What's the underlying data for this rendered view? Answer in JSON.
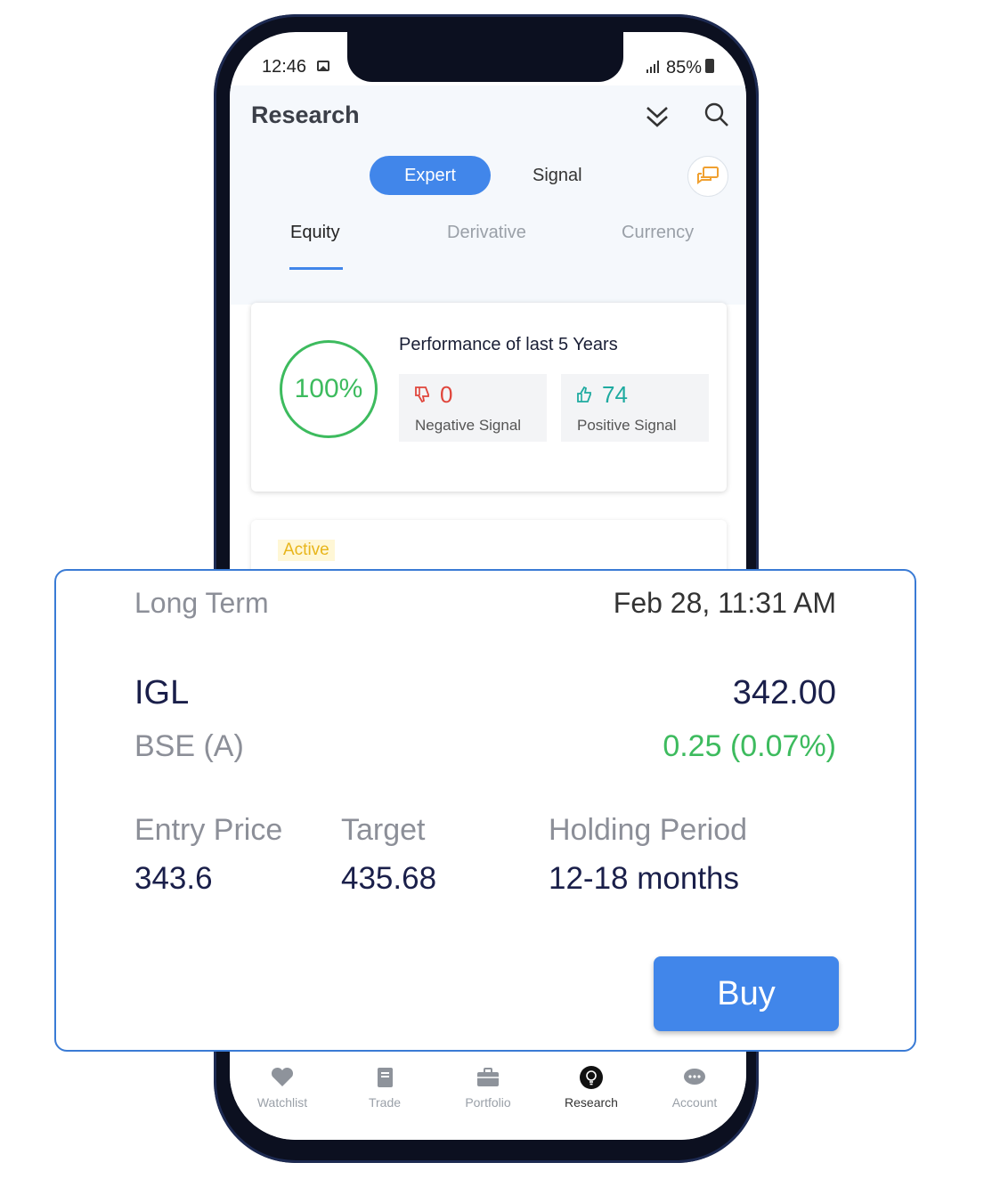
{
  "status_bar": {
    "time": "12:46",
    "battery": "85%"
  },
  "header": {
    "title": "Research",
    "toggle": {
      "expert": "Expert",
      "signal": "Signal"
    },
    "tabs": [
      {
        "label": "Equity",
        "active": true
      },
      {
        "label": "Derivative",
        "active": false
      },
      {
        "label": "Currency",
        "active": false
      }
    ]
  },
  "performance": {
    "title": "Performance of last 5 Years",
    "percent": "100%",
    "negative": {
      "value": "0",
      "label": "Negative Signal"
    },
    "positive": {
      "value": "74",
      "label": "Positive Signal"
    }
  },
  "next_card": {
    "badge": "Active"
  },
  "call_card": {
    "term": "Long Term",
    "datetime": "Feb 28, 11:31 AM",
    "symbol": "IGL",
    "price": "342.00",
    "exchange": "BSE (A)",
    "change": "0.25 (0.07%)",
    "entry_label": "Entry Price",
    "entry_value": "343.6",
    "target_label": "Target",
    "target_value": "435.68",
    "holding_label": "Holding Period",
    "holding_value": "12-18 months",
    "buy_label": "Buy"
  },
  "bottom_nav": {
    "items": [
      {
        "label": "Watchlist",
        "icon": "heart-icon"
      },
      {
        "label": "Trade",
        "icon": "book-icon"
      },
      {
        "label": "Portfolio",
        "icon": "briefcase-icon"
      },
      {
        "label": "Research",
        "icon": "lightbulb-icon",
        "active": true
      },
      {
        "label": "Account",
        "icon": "chat-bubble-icon"
      }
    ]
  },
  "colors": {
    "accent": "#4186ea",
    "positive": "#3dbb5e",
    "negative": "#e0453b",
    "teal": "#1eaaa0",
    "badge": "#e8b51b"
  }
}
